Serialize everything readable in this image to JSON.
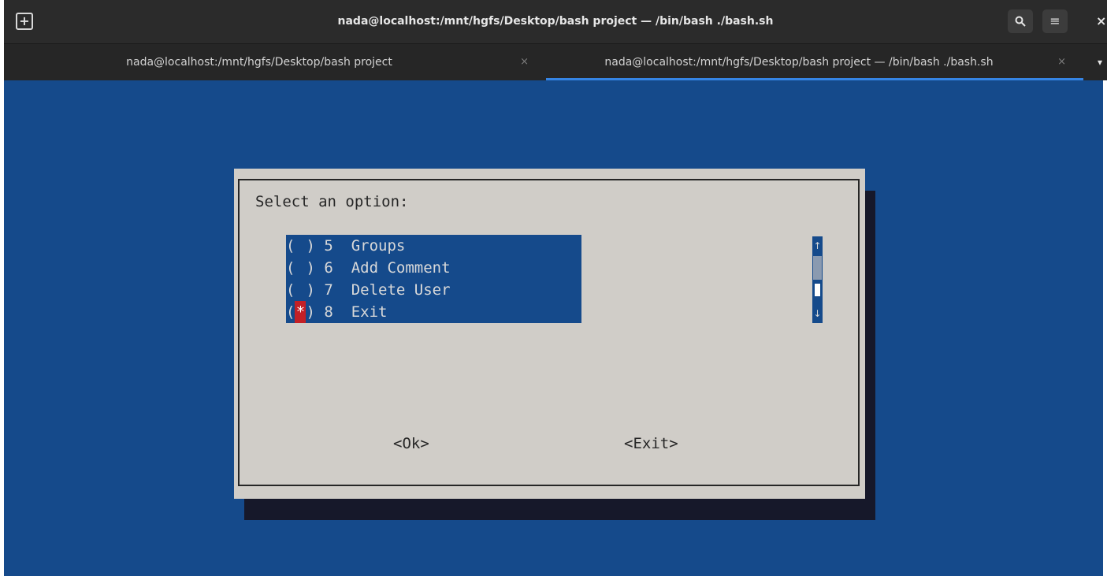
{
  "window": {
    "title": "nada@localhost:/mnt/hgfs/Desktop/bash project — /bin/bash ./bash.sh",
    "new_tab_icon": "+",
    "search_icon": "⚲",
    "menu_icon": "≡",
    "close_icon": "×"
  },
  "tabs": [
    {
      "label": "nada@localhost:/mnt/hgfs/Desktop/bash project",
      "close": "×",
      "active": false
    },
    {
      "label": "nada@localhost:/mnt/hgfs/Desktop/bash project — /bin/bash ./bash.sh",
      "close": "×",
      "active": true
    }
  ],
  "tab_menu_icon": "▾",
  "dialog": {
    "prompt": "Select an option:",
    "items": [
      {
        "open": "(",
        "mark": " ",
        "close": ")",
        "num": "5",
        "label": "Groups",
        "selected": false
      },
      {
        "open": "(",
        "mark": " ",
        "close": ")",
        "num": "6",
        "label": "Add Comment",
        "selected": false
      },
      {
        "open": "(",
        "mark": " ",
        "close": ")",
        "num": "7",
        "label": "Delete User",
        "selected": false
      },
      {
        "open": "(",
        "mark": "*",
        "close": ")",
        "num": "8",
        "label": "Exit",
        "selected": true
      }
    ],
    "scroll_up": "↑",
    "scroll_down": "↓",
    "ok_button": "<Ok>",
    "exit_button": "<Exit>"
  },
  "colors": {
    "terminal_bg": "#154a8b",
    "dialog_bg": "#d0cdc8",
    "selection": "#c32026",
    "tab_indicator": "#3584e4"
  }
}
